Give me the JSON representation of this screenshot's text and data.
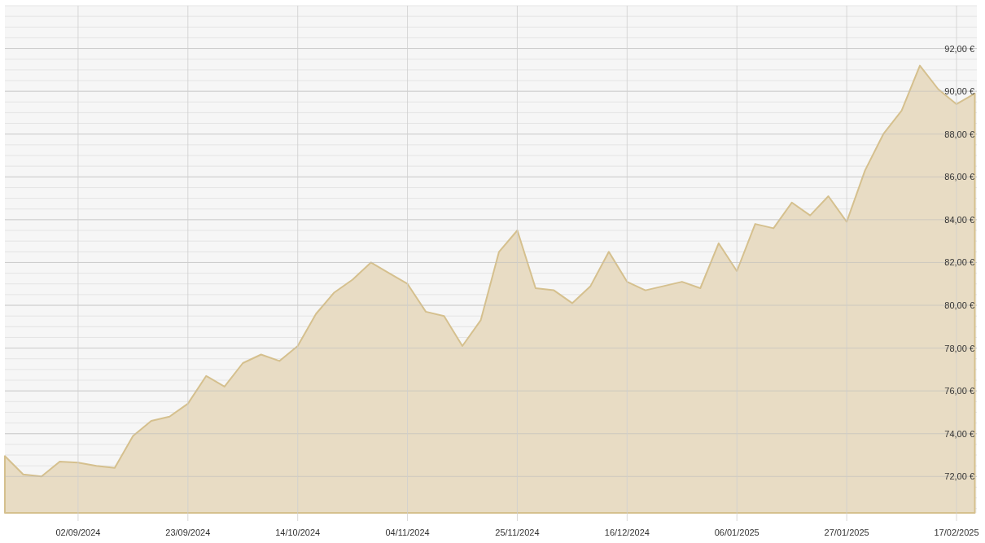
{
  "chart_data": {
    "type": "area",
    "grid": true,
    "ylim": [
      70.3,
      94
    ],
    "categories": [
      null,
      null,
      null,
      null,
      "02/09/2024",
      null,
      null,
      null,
      null,
      null,
      "23/09/2024",
      null,
      null,
      null,
      null,
      null,
      "14/10/2024",
      null,
      null,
      null,
      null,
      null,
      "04/11/2024",
      null,
      null,
      null,
      null,
      null,
      "25/11/2024",
      null,
      null,
      null,
      null,
      null,
      "16/12/2024",
      null,
      null,
      null,
      null,
      null,
      "06/01/2025",
      null,
      null,
      null,
      null,
      null,
      "27/01/2025",
      null,
      null,
      null,
      null,
      null,
      "17/02/2025",
      null
    ],
    "yticks": [
      {
        "value": 72,
        "label": "72,00 €"
      },
      {
        "value": 74,
        "label": "74,00 €"
      },
      {
        "value": 76,
        "label": "76,00 €"
      },
      {
        "value": 78,
        "label": "78,00 €"
      },
      {
        "value": 80,
        "label": "80,00 €"
      },
      {
        "value": 82,
        "label": "82,00 €"
      },
      {
        "value": 84,
        "label": "84,00 €"
      },
      {
        "value": 86,
        "label": "86,00 €"
      },
      {
        "value": 88,
        "label": "88,00 €"
      },
      {
        "value": 90,
        "label": "90,00 €"
      },
      {
        "value": 92,
        "label": "92,00 €"
      }
    ],
    "series": [
      {
        "color": "#e8dcc4",
        "values": [
          72.95,
          72.1,
          72.0,
          72.7,
          72.65,
          72.5,
          72.4,
          73.9,
          74.6,
          74.8,
          75.4,
          76.7,
          76.2,
          77.3,
          77.7,
          77.4,
          78.1,
          79.6,
          80.6,
          81.2,
          82.0,
          81.5,
          81.0,
          79.7,
          79.5,
          78.1,
          79.3,
          82.5,
          83.5,
          80.8,
          80.7,
          80.1,
          80.9,
          82.5,
          81.1,
          80.7,
          80.9,
          81.1,
          80.8,
          82.9,
          81.6,
          83.8,
          83.6,
          84.8,
          84.2,
          85.1,
          83.9,
          86.3,
          88.0,
          89.1,
          91.2,
          90.1,
          89.4,
          89.9
        ]
      }
    ]
  }
}
